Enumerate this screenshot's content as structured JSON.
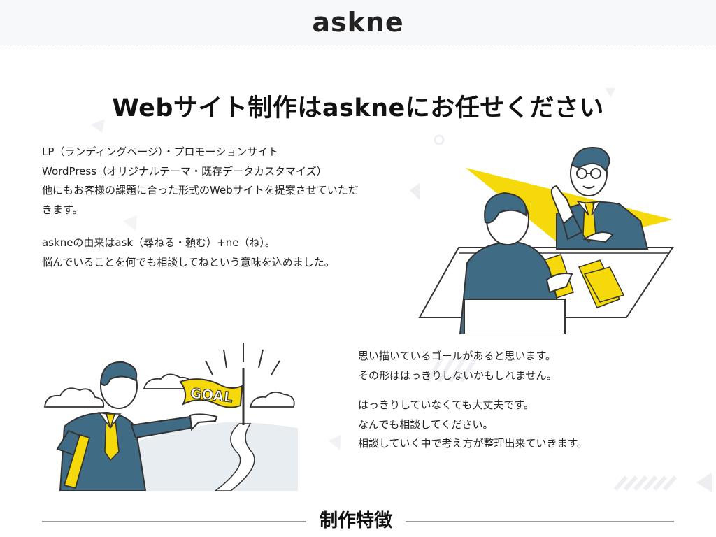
{
  "header": {
    "logo": "askne"
  },
  "hero": {
    "title": "Webサイト制作はaskneにお任せください"
  },
  "intro": {
    "lines": [
      "LP（ランディングページ）・プロモーションサイト",
      "WordPress（オリジナルテーマ・既存データカスタマイズ）",
      "他にもお客様の課題に合った形式のWebサイトを提案させていただ",
      "きます。"
    ],
    "origin_lines": [
      "askneの由来はask（尋ねる・頼む）+ne（ね）。",
      "悩んでいることを何でも相談してねという意味を込めました。"
    ]
  },
  "goal": {
    "lines": [
      "思い描いているゴールがあると思います。",
      "その形ははっきりしないかもしれません。"
    ],
    "reassure_lines": [
      "はっきりしていなくても大丈夫です。",
      "なんでも相談してください。",
      "相談していく中で考え方が整理出来ていきます。"
    ],
    "flag_text": "GOAL"
  },
  "features": {
    "title": "制作特徴"
  },
  "colors": {
    "accent_yellow": "#f5d90a",
    "suit_blue": "#3f6b84",
    "deco_gray": "#d9dce3",
    "header_bg": "#f7f8fa"
  }
}
